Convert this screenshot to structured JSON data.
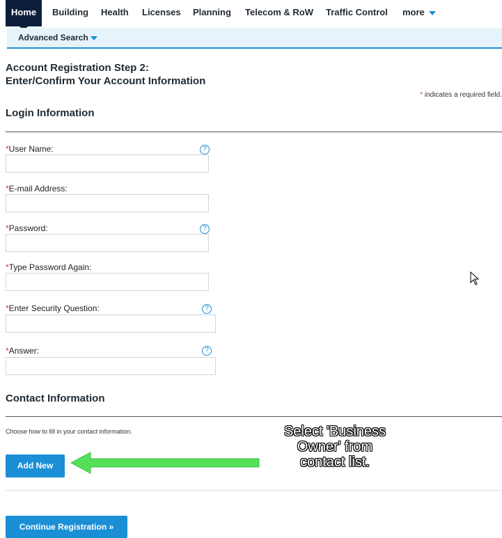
{
  "nav": {
    "tabs": [
      "Home",
      "Building",
      "Health",
      "Licenses",
      "Planning",
      "Telecom & RoW",
      "Traffic Control",
      "more"
    ],
    "active": "Home"
  },
  "subnav": {
    "advanced_search": "Advanced Search"
  },
  "page": {
    "title_line1": "Account Registration Step 2:",
    "title_line2": "Enter/Confirm Your Account Information",
    "required_star": "*",
    "required_note": "indicates a required field."
  },
  "login": {
    "heading": "Login Information",
    "fields": [
      {
        "label": "User Name:",
        "help": true
      },
      {
        "label": "E-mail Address:",
        "help": false
      },
      {
        "label": "Password:",
        "help": true
      },
      {
        "label": "Type Password Again:",
        "help": false
      },
      {
        "label": "Enter Security Question:",
        "help": true
      },
      {
        "label": "Answer:",
        "help": true
      }
    ]
  },
  "contact": {
    "heading": "Contact Information",
    "instruction": "Choose how to fill in your contact information.",
    "add_new": "Add New"
  },
  "continue_button": "Continue Registration »",
  "annotation": {
    "callout_line1": "Select 'Business",
    "callout_line2": "Owner' from",
    "callout_line3": "contact list."
  },
  "colors": {
    "accent": "#1a8fd6",
    "nav_active": "#0b1f3b",
    "required": "#d9412f",
    "arrow": "#55e05a"
  },
  "icons": {
    "help": "question-circle-icon",
    "caret": "caret-down-icon",
    "cursor": "mouse-pointer-icon"
  }
}
